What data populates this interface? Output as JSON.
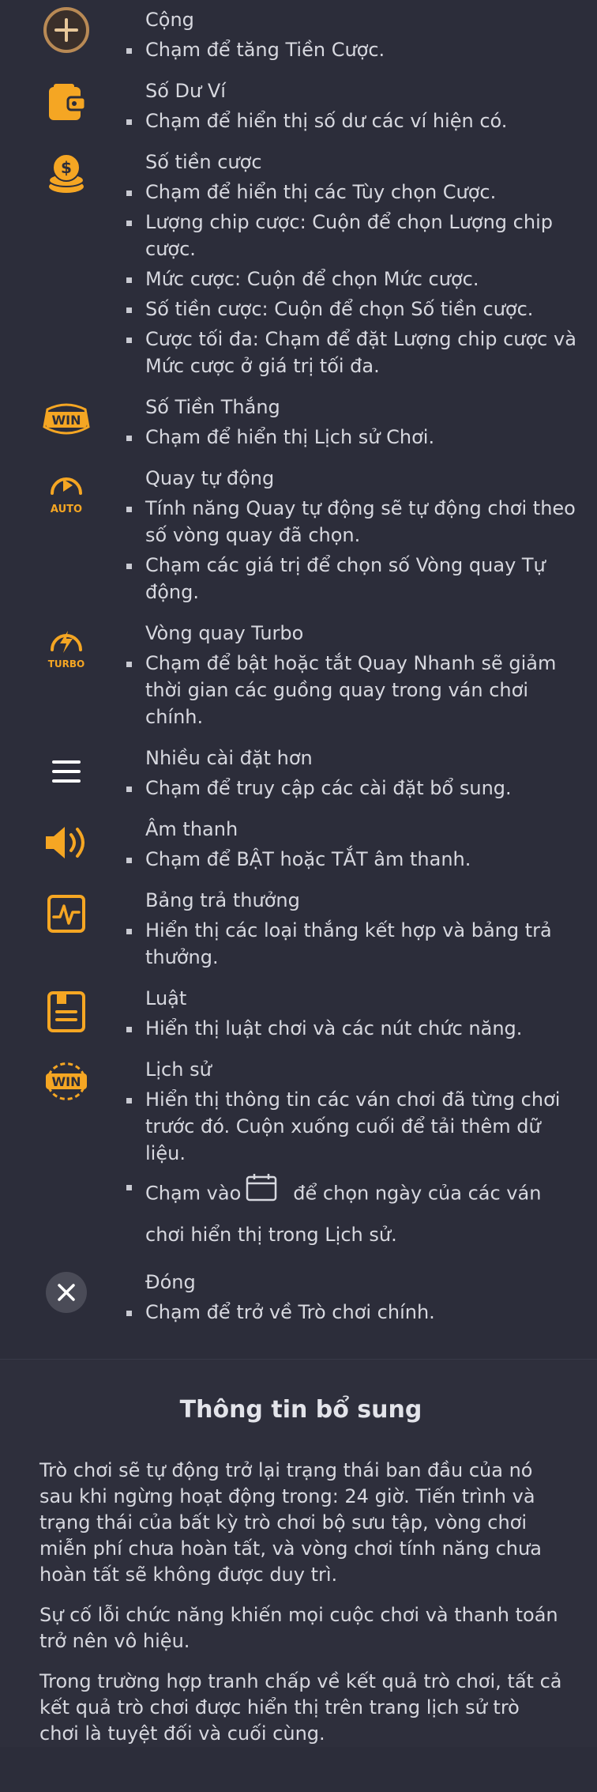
{
  "items": [
    {
      "title": "Cộng",
      "icon": "plus-circle-icon",
      "bullets": [
        "Chạm để tăng Tiền Cược."
      ]
    },
    {
      "title": "Số Dư Ví",
      "icon": "wallet-icon",
      "bullets": [
        "Chạm để hiển thị số dư các ví hiện có."
      ]
    },
    {
      "title": "Số tiền cược",
      "icon": "coins-icon",
      "bullets": [
        "Chạm để hiển thị các Tùy chọn Cược.",
        "Lượng chip cược: Cuộn để chọn Lượng chip cược.",
        "Mức cược: Cuộn để chọn Mức cược.",
        "Số tiền cược: Cuộn để chọn Số tiền cược.",
        "Cược tối đa: Chạm để đặt Lượng chip cược và Mức cược ở giá trị tối đa."
      ]
    },
    {
      "title": "Số Tiền Thắng",
      "icon": "win-badge-icon",
      "icon_text": "WIN",
      "bullets": [
        "Chạm để hiển thị Lịch sử Chơi."
      ]
    },
    {
      "title": "Quay tự động",
      "icon": "autoplay-icon",
      "icon_text": "AUTO",
      "bullets": [
        "Tính năng Quay tự động sẽ tự động chơi theo số vòng quay đã chọn.",
        "Chạm các giá trị để chọn số Vòng quay Tự động."
      ]
    },
    {
      "title": "Vòng quay Turbo",
      "icon": "turbo-icon",
      "icon_text": "TURBO",
      "bullets": [
        "Chạm để bật hoặc tắt Quay Nhanh sẽ giảm thời gian các guồng quay trong ván chơi chính."
      ]
    },
    {
      "title": "Nhiều cài đặt hơn",
      "icon": "menu-icon",
      "bullets": [
        "Chạm để truy cập các cài đặt bổ sung."
      ]
    },
    {
      "title": "Âm thanh",
      "icon": "speaker-icon",
      "bullets": [
        "Chạm để BẬT hoặc TẮT âm thanh."
      ]
    },
    {
      "title": "Bảng trả thưởng",
      "icon": "paytable-icon",
      "bullets": [
        "Hiển thị các loại thắng kết hợp và bảng trả thưởng."
      ]
    },
    {
      "title": "Luật",
      "icon": "rules-icon",
      "bullets": [
        "Hiển thị luật chơi và các nút chức năng."
      ]
    },
    {
      "title": "Lịch sử",
      "icon": "history-icon",
      "icon_text": "WIN",
      "bullets": [
        "Hiển thị thông tin các ván chơi đã từng chơi trước đó. Cuộn xuống cuối để tải thêm dữ liệu."
      ],
      "calendar_before": "Chạm vào",
      "calendar_after": "để chọn ngày của các ván chơi hiển thị trong Lịch sử."
    },
    {
      "title": "Đóng",
      "icon": "close-icon",
      "bullets": [
        "Chạm để trở về Trò chơi chính."
      ]
    }
  ],
  "additional": {
    "heading": "Thông tin bổ sung",
    "paragraphs": [
      "Trò chơi sẽ tự động trở lại trạng thái ban đầu của nó sau khi ngừng hoạt động trong: 24 giờ. Tiến trình và trạng thái của bất kỳ trò chơi bộ sưu tập, vòng chơi miễn phí chưa hoàn tất, và vòng chơi tính năng chưa hoàn tất sẽ không được duy trì.",
      "Sự cố lỗi chức năng khiến mọi cuộc chơi và thanh toán trở nên vô hiệu.",
      "Trong trường hợp tranh chấp về kết quả trò chơi, tất cả kết quả trò chơi được hiển thị trên trang lịch sử trò chơi là tuyệt đối và cuối cùng."
    ]
  },
  "colors": {
    "accent": "#f5a623",
    "background": "#2c2d3a",
    "text": "#d7d8df"
  }
}
